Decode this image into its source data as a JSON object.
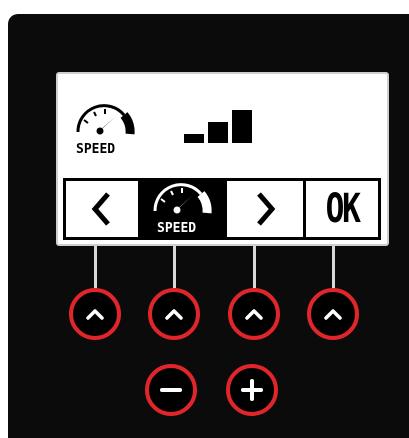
{
  "display": {
    "status_icon": "speedometer-icon",
    "status_label": "SPEED",
    "signal_icon": "signal-bars-icon",
    "signal_level": 3,
    "signal_max": 3,
    "menu": {
      "prev_icon": "chevron-left-icon",
      "selected_icon": "speedometer-icon",
      "selected_label": "SPEED",
      "next_icon": "chevron-right-icon",
      "ok_label": "OK"
    }
  },
  "buttons": {
    "softkeys": [
      {
        "icon": "chevron-up-icon"
      },
      {
        "icon": "chevron-up-icon"
      },
      {
        "icon": "chevron-up-icon"
      },
      {
        "icon": "chevron-up-icon"
      }
    ],
    "minus_icon": "minus-icon",
    "plus_icon": "plus-icon"
  },
  "colors": {
    "device_body": "#0b0b0b",
    "lcd_background": "#ffffff",
    "button_ring": "#e0262b",
    "lead_line": "#d9d9d9"
  }
}
